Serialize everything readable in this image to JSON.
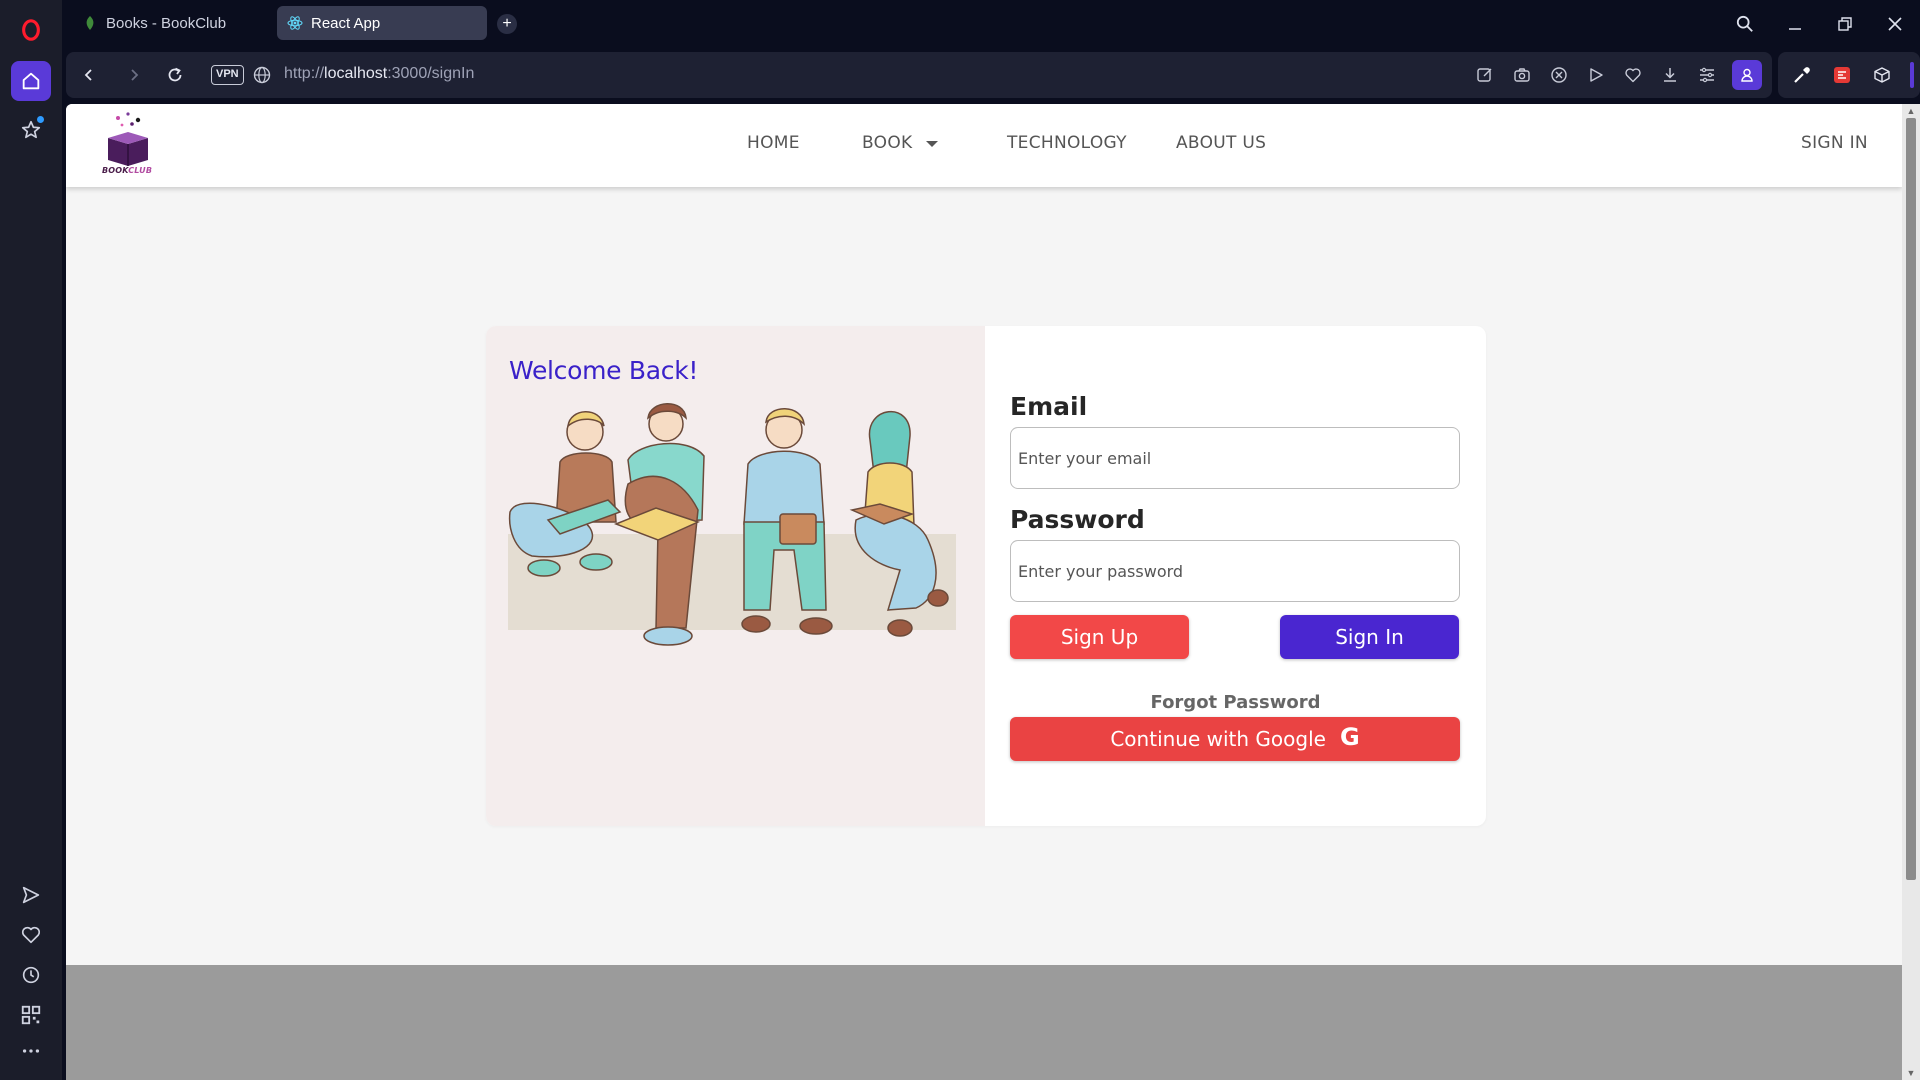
{
  "browser": {
    "tabs": [
      {
        "title": "Books - BookClub",
        "active": false
      },
      {
        "title": "React App",
        "active": true
      }
    ],
    "new_tab_label": "+",
    "vpn_label": "VPN",
    "url_prefix": "http://",
    "url_host": "localhost",
    "url_path": ":3000/signIn",
    "accent_color": "#5a3ad8"
  },
  "app": {
    "brand": {
      "word1": "BOOK",
      "word2": "CLUB"
    },
    "nav": {
      "home": "HOME",
      "book": "BOOK",
      "technology": "TECHNOLOGY",
      "about": "ABOUT US",
      "signin": "SIGN IN"
    },
    "welcome": "Welcome Back!",
    "form": {
      "email_label": "Email",
      "email_placeholder": "Enter your email",
      "password_label": "Password",
      "password_placeholder": "Enter your password",
      "signup_button": "Sign Up",
      "signin_button": "Sign In",
      "forgot_password": "Forgot Password",
      "google_button": "Continue with Google",
      "google_icon": "G"
    },
    "colors": {
      "signup": "#f24848",
      "signin": "#4a26d0",
      "google": "#ea4343",
      "welcome_text": "#3a21c9"
    }
  }
}
